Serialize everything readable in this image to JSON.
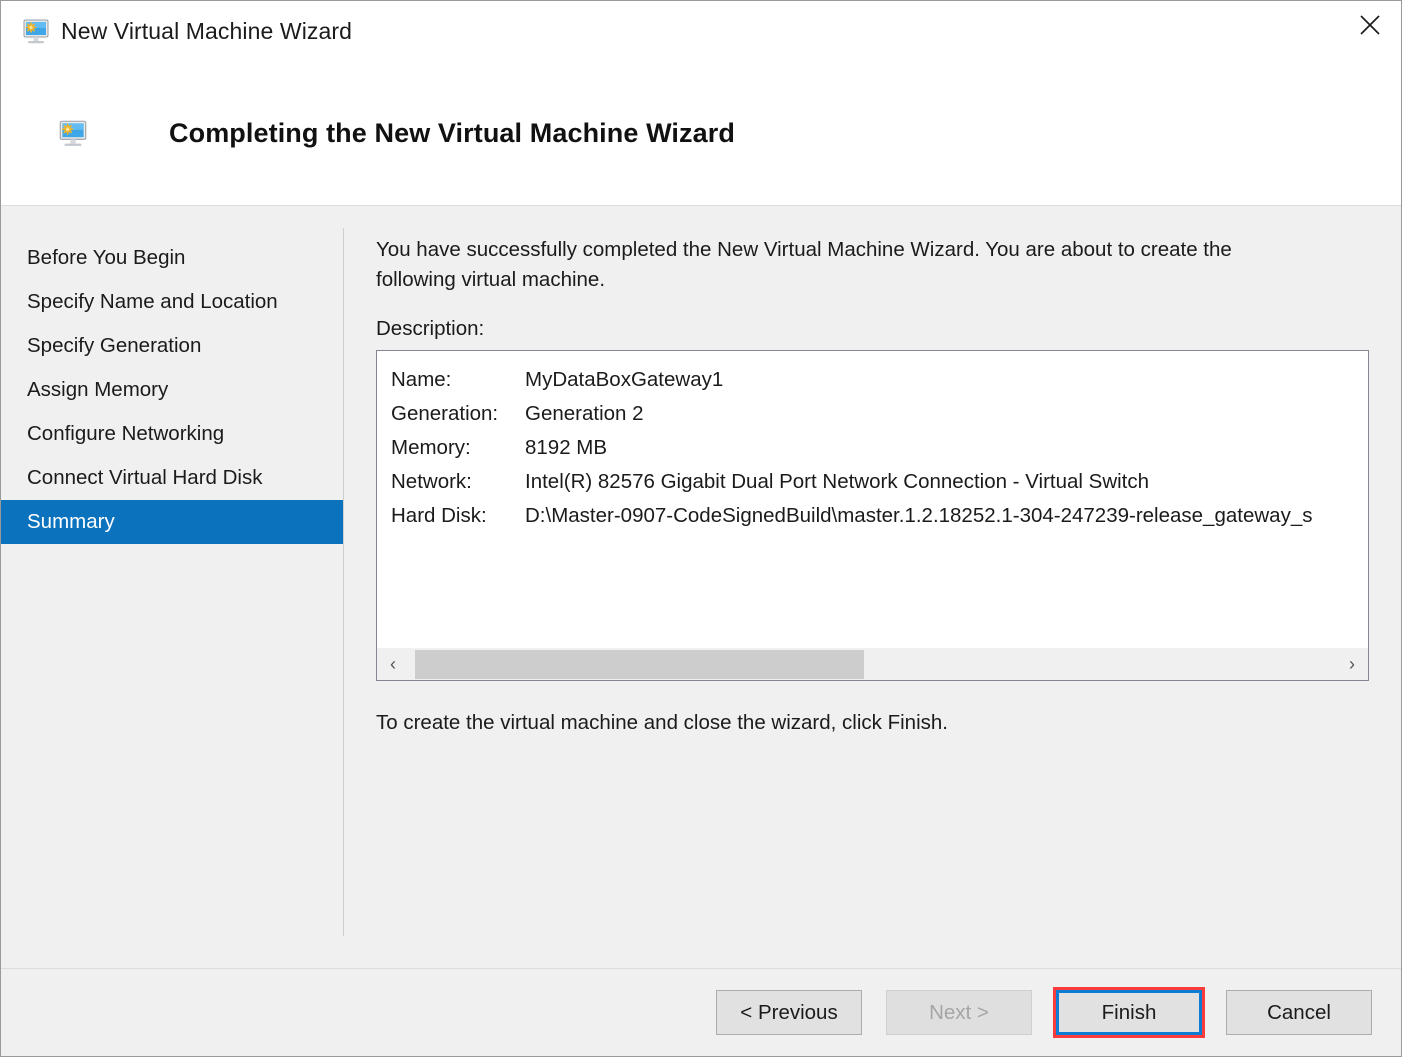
{
  "window": {
    "title": "New Virtual Machine Wizard",
    "icon": "virtual-machine-icon",
    "close_label": "✕"
  },
  "header": {
    "title": "Completing the New Virtual Machine Wizard",
    "icon": "virtual-machine-icon"
  },
  "sidebar": {
    "items": [
      {
        "label": "Before You Begin",
        "active": false
      },
      {
        "label": "Specify Name and Location",
        "active": false
      },
      {
        "label": "Specify Generation",
        "active": false
      },
      {
        "label": "Assign Memory",
        "active": false
      },
      {
        "label": "Configure Networking",
        "active": false
      },
      {
        "label": "Connect Virtual Hard Disk",
        "active": false
      },
      {
        "label": "Summary",
        "active": true
      }
    ],
    "active_color": "#0b72be"
  },
  "content": {
    "intro": "You have successfully completed the New Virtual Machine Wizard. You are about to create the following virtual machine.",
    "description_label": "Description:",
    "summary_rows": [
      {
        "key": "Name:",
        "value": "MyDataBoxGateway1"
      },
      {
        "key": "Generation:",
        "value": "Generation 2"
      },
      {
        "key": "Memory:",
        "value": "8192 MB"
      },
      {
        "key": "Network:",
        "value": "Intel(R) 82576 Gigabit Dual Port Network Connection - Virtual Switch"
      },
      {
        "key": "Hard Disk:",
        "value": "D:\\Master-0907-CodeSignedBuild\\master.1.2.18252.1-304-247239-release_gateway_s"
      }
    ],
    "scrollbar": {
      "left_arrow": "‹",
      "right_arrow": "›"
    },
    "closing_note": "To create the virtual machine and close the wizard, click Finish."
  },
  "footer": {
    "previous_label": "< Previous",
    "next_label": "Next >",
    "finish_label": "Finish",
    "cancel_label": "Cancel",
    "highlight_color": "#fa3c3c",
    "focus_color": "#0c7cd5"
  }
}
